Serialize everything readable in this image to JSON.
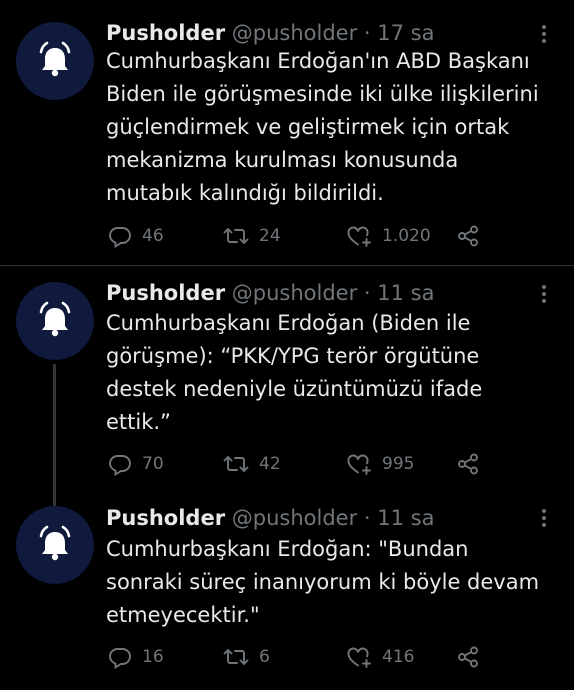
{
  "tweets": [
    {
      "name": "Pusholder",
      "handle": "@pusholder",
      "separator": "·",
      "time": "17 sa",
      "text": "Cumhurbaşkanı Erdoğan'ın ABD Başkanı\nBiden ile görüşmesinde iki ülke ilişkilerini\ngüçlendirmek ve geliştirmek için ortak\nmekanizma kurulması konusunda\nmutabık kalındığı bildirildi.",
      "replies": "46",
      "retweets": "24",
      "likes": "1.020"
    },
    {
      "name": "Pusholder",
      "handle": "@pusholder",
      "separator": "·",
      "time": "11 sa",
      "text": "Cumhurbaşkanı Erdoğan (Biden ile\ngörüşme): “PKK/YPG terör örgütüne\ndestek nedeniyle üzüntümüzü ifade\nettik.”",
      "replies": "70",
      "retweets": "42",
      "likes": "995"
    },
    {
      "name": "Pusholder",
      "handle": "@pusholder",
      "separator": "·",
      "time": "11 sa",
      "text": "Cumhurbaşkanı Erdoğan: \"Bundan\nsonraki süreç inanıyorum ki böyle devam\netmeyecektir.\"",
      "replies": "16",
      "retweets": "6",
      "likes": "416"
    }
  ],
  "icons": {
    "avatar": "bell-icon",
    "more": "more-icon",
    "reply": "reply-icon",
    "retweet": "retweet-icon",
    "like": "heart-icon",
    "share": "share-icon"
  },
  "colors": {
    "background": "#000000",
    "text": "#e7e9ea",
    "muted": "#71767b",
    "avatar_bg": "#0f1a3c",
    "divider": "#2f3336"
  }
}
